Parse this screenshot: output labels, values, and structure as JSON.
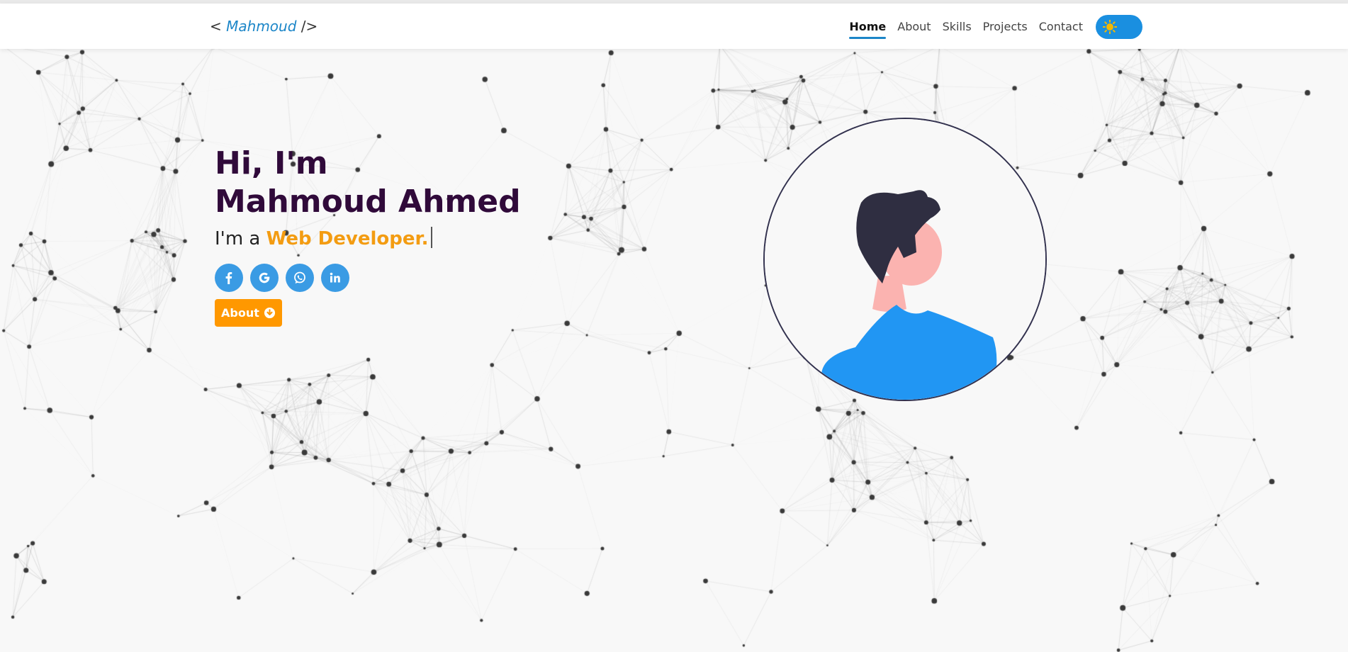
{
  "header": {
    "logo": {
      "open": "<",
      "name": "Mahmoud",
      "close": "/>"
    },
    "nav": [
      {
        "label": "Home",
        "active": true
      },
      {
        "label": "About"
      },
      {
        "label": "Skills"
      },
      {
        "label": "Projects"
      },
      {
        "label": "Contact"
      }
    ],
    "theme_toggle": {
      "icon": "sun-icon",
      "state": "light"
    }
  },
  "hero": {
    "greeting": "Hi, I'm",
    "name": "Mahmoud Ahmed",
    "role_prefix": "I'm a ",
    "role_highlight": "Web Developer.",
    "socials": [
      {
        "icon": "facebook-icon",
        "letter": "f"
      },
      {
        "icon": "google-icon",
        "letter": "G"
      },
      {
        "icon": "whatsapp-icon"
      },
      {
        "icon": "linkedin-icon",
        "letter": "in"
      }
    ],
    "about_button": {
      "label": "About",
      "icon": "arrow-down-circle-icon"
    }
  },
  "avatar": {
    "icon": "person-avatar-icon"
  },
  "colors": {
    "accent_blue": "#1c86c8",
    "accent_orange": "#ff9800",
    "heading": "#300a3a",
    "social_bg": "#3a9be4",
    "toggle_bg": "#1a8fe0"
  }
}
